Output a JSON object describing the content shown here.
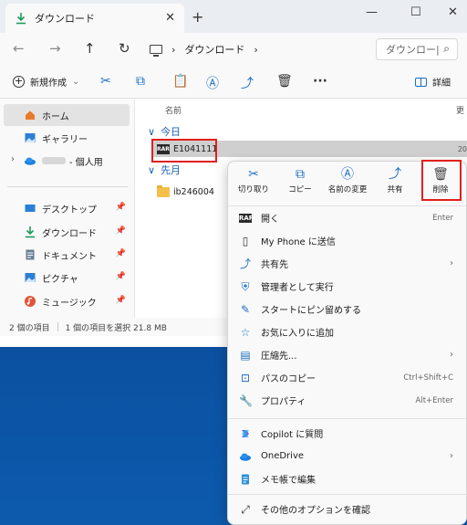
{
  "window": {
    "tab_title": "ダウンロード",
    "tab_close": "✕",
    "tab_add": "+",
    "win_min": "—",
    "win_max": "☐",
    "win_close": "✕"
  },
  "address": {
    "path_chevron_1": "›",
    "path_label": "ダウンロード",
    "path_chevron_2": "›",
    "search_placeholder": "ダウンロー|"
  },
  "toolbar": {
    "new_label": "新規作成",
    "new_chevron": "⌄",
    "more": "···",
    "details_label": "詳細"
  },
  "sidebar": {
    "items": [
      {
        "label": "ホーム"
      },
      {
        "label": "ギャラリー"
      },
      {
        "label": "- 個人用"
      },
      {
        "label": "デスクトップ"
      },
      {
        "label": "ダウンロード"
      },
      {
        "label": "ドキュメント"
      },
      {
        "label": "ピクチャ"
      },
      {
        "label": "ミュージック"
      }
    ]
  },
  "files": {
    "column_name": "名前",
    "column_more": "更",
    "group_today": "今日",
    "group_lastmonth": "先月",
    "group_chevron": "∨",
    "rows": [
      {
        "name": "E1041111",
        "trail": "20"
      },
      {
        "name": "ib246004"
      }
    ]
  },
  "status": {
    "count": "2 個の項目",
    "selected": "1 個の項目を選択  21.8 MB"
  },
  "context_menu": {
    "quick": [
      {
        "label": "切り取り"
      },
      {
        "label": "コピー"
      },
      {
        "label": "名前の変更"
      },
      {
        "label": "共有"
      },
      {
        "label": "削除"
      }
    ],
    "items": [
      {
        "label": "開く",
        "shortcut": "Enter"
      },
      {
        "label": "My Phone に送信"
      },
      {
        "label": "共有先",
        "sub": "›"
      },
      {
        "label": "管理者として実行"
      },
      {
        "label": "スタートにピン留めする"
      },
      {
        "label": "お気に入りに追加"
      },
      {
        "label": "圧縮先...",
        "sub": "›"
      },
      {
        "label": "パスのコピー",
        "shortcut": "Ctrl+Shift+C"
      },
      {
        "label": "プロパティ",
        "shortcut": "Alt+Enter"
      },
      {
        "label": "Copilot に質問"
      },
      {
        "label": "OneDrive",
        "sub": "›"
      },
      {
        "label": "メモ帳で編集"
      },
      {
        "label": "その他のオプションを確認"
      }
    ]
  },
  "colors": {
    "accent": "#1a6ec4",
    "highlight_red": "#e0201c",
    "desktop": "#0b4f9e"
  }
}
